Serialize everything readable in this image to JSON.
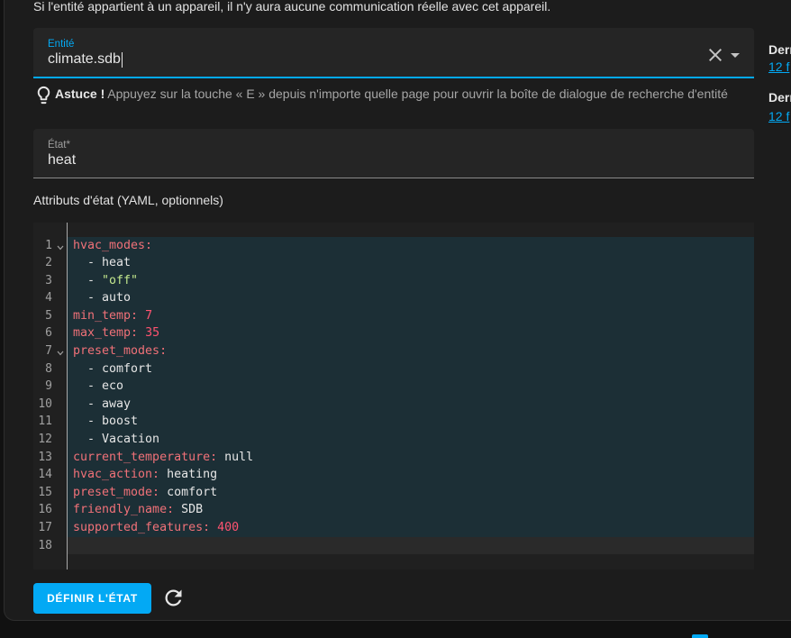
{
  "notice": "Si l'entité appartient à un appareil, il n'y aura aucune communication réelle avec cet appareil.",
  "entity_field": {
    "label": "Entité",
    "value": "climate.sdb",
    "clear_icon": "close-icon",
    "dropdown_icon": "menu-down-icon"
  },
  "tip": {
    "icon": "lightbulb-outline-icon",
    "title": "Astuce !",
    "text": "Appuyez sur la touche « E » depuis n'importe quelle page pour ouvrir la boîte de dialogue de recherche d'entité"
  },
  "state_field": {
    "label": "État*",
    "value": "heat"
  },
  "attributes_label": "Attributs d'état (YAML, optionnels)",
  "editor": {
    "fold_icon": "chevron-down-icon",
    "lines": [
      {
        "number": "1",
        "fold": true,
        "selected": true,
        "tokens": [
          {
            "type": "key",
            "text": "hvac_modes:"
          }
        ]
      },
      {
        "number": "2",
        "selected": true,
        "tokens": [
          {
            "type": "plain",
            "text": "  - heat"
          }
        ]
      },
      {
        "number": "3",
        "selected": true,
        "tokens": [
          {
            "type": "plain",
            "text": "  - "
          },
          {
            "type": "string",
            "text": "\"off\""
          }
        ]
      },
      {
        "number": "4",
        "selected": true,
        "tokens": [
          {
            "type": "plain",
            "text": "  - auto"
          }
        ]
      },
      {
        "number": "5",
        "selected": true,
        "tokens": [
          {
            "type": "key",
            "text": "min_temp:"
          },
          {
            "type": "number",
            "text": " 7"
          }
        ]
      },
      {
        "number": "6",
        "selected": true,
        "tokens": [
          {
            "type": "key",
            "text": "max_temp:"
          },
          {
            "type": "number",
            "text": " 35"
          }
        ]
      },
      {
        "number": "7",
        "fold": true,
        "selected": true,
        "tokens": [
          {
            "type": "key",
            "text": "preset_modes:"
          }
        ]
      },
      {
        "number": "8",
        "selected": true,
        "tokens": [
          {
            "type": "plain",
            "text": "  - comfort"
          }
        ]
      },
      {
        "number": "9",
        "selected": true,
        "tokens": [
          {
            "type": "plain",
            "text": "  - eco"
          }
        ]
      },
      {
        "number": "10",
        "selected": true,
        "tokens": [
          {
            "type": "plain",
            "text": "  - away"
          }
        ]
      },
      {
        "number": "11",
        "selected": true,
        "tokens": [
          {
            "type": "plain",
            "text": "  - boost"
          }
        ]
      },
      {
        "number": "12",
        "selected": true,
        "tokens": [
          {
            "type": "plain",
            "text": "  - Vacation"
          }
        ]
      },
      {
        "number": "13",
        "selected": true,
        "tokens": [
          {
            "type": "key",
            "text": "current_temperature:"
          },
          {
            "type": "plain",
            "text": " null"
          }
        ]
      },
      {
        "number": "14",
        "selected": true,
        "tokens": [
          {
            "type": "key",
            "text": "hvac_action:"
          },
          {
            "type": "plain",
            "text": " heating"
          }
        ]
      },
      {
        "number": "15",
        "selected": true,
        "tokens": [
          {
            "type": "key",
            "text": "preset_mode:"
          },
          {
            "type": "plain",
            "text": " comfort"
          }
        ]
      },
      {
        "number": "16",
        "selected": true,
        "tokens": [
          {
            "type": "key",
            "text": "friendly_name:"
          },
          {
            "type": "plain",
            "text": " SDB"
          }
        ]
      },
      {
        "number": "17",
        "selected": true,
        "tokens": [
          {
            "type": "key",
            "text": "supported_features:"
          },
          {
            "type": "number",
            "text": " 400"
          }
        ]
      },
      {
        "number": "18",
        "active": true,
        "tokens": []
      }
    ]
  },
  "set_state_button": {
    "label": "DÉFINIR L'ÉTAT"
  },
  "refresh_icon": "refresh-icon",
  "side_info": [
    {
      "label": "Dern",
      "link": "12 f"
    },
    {
      "label": "Dern",
      "link": "12 f"
    }
  ],
  "colors": {
    "page_background": "#111111",
    "card_background": "#1c1c1c",
    "accent": "#03a9f4",
    "yaml_key": "#f07178",
    "yaml_string": "#c3e88d",
    "yaml_number": "#ff5370",
    "selection": "#1c2f36"
  }
}
